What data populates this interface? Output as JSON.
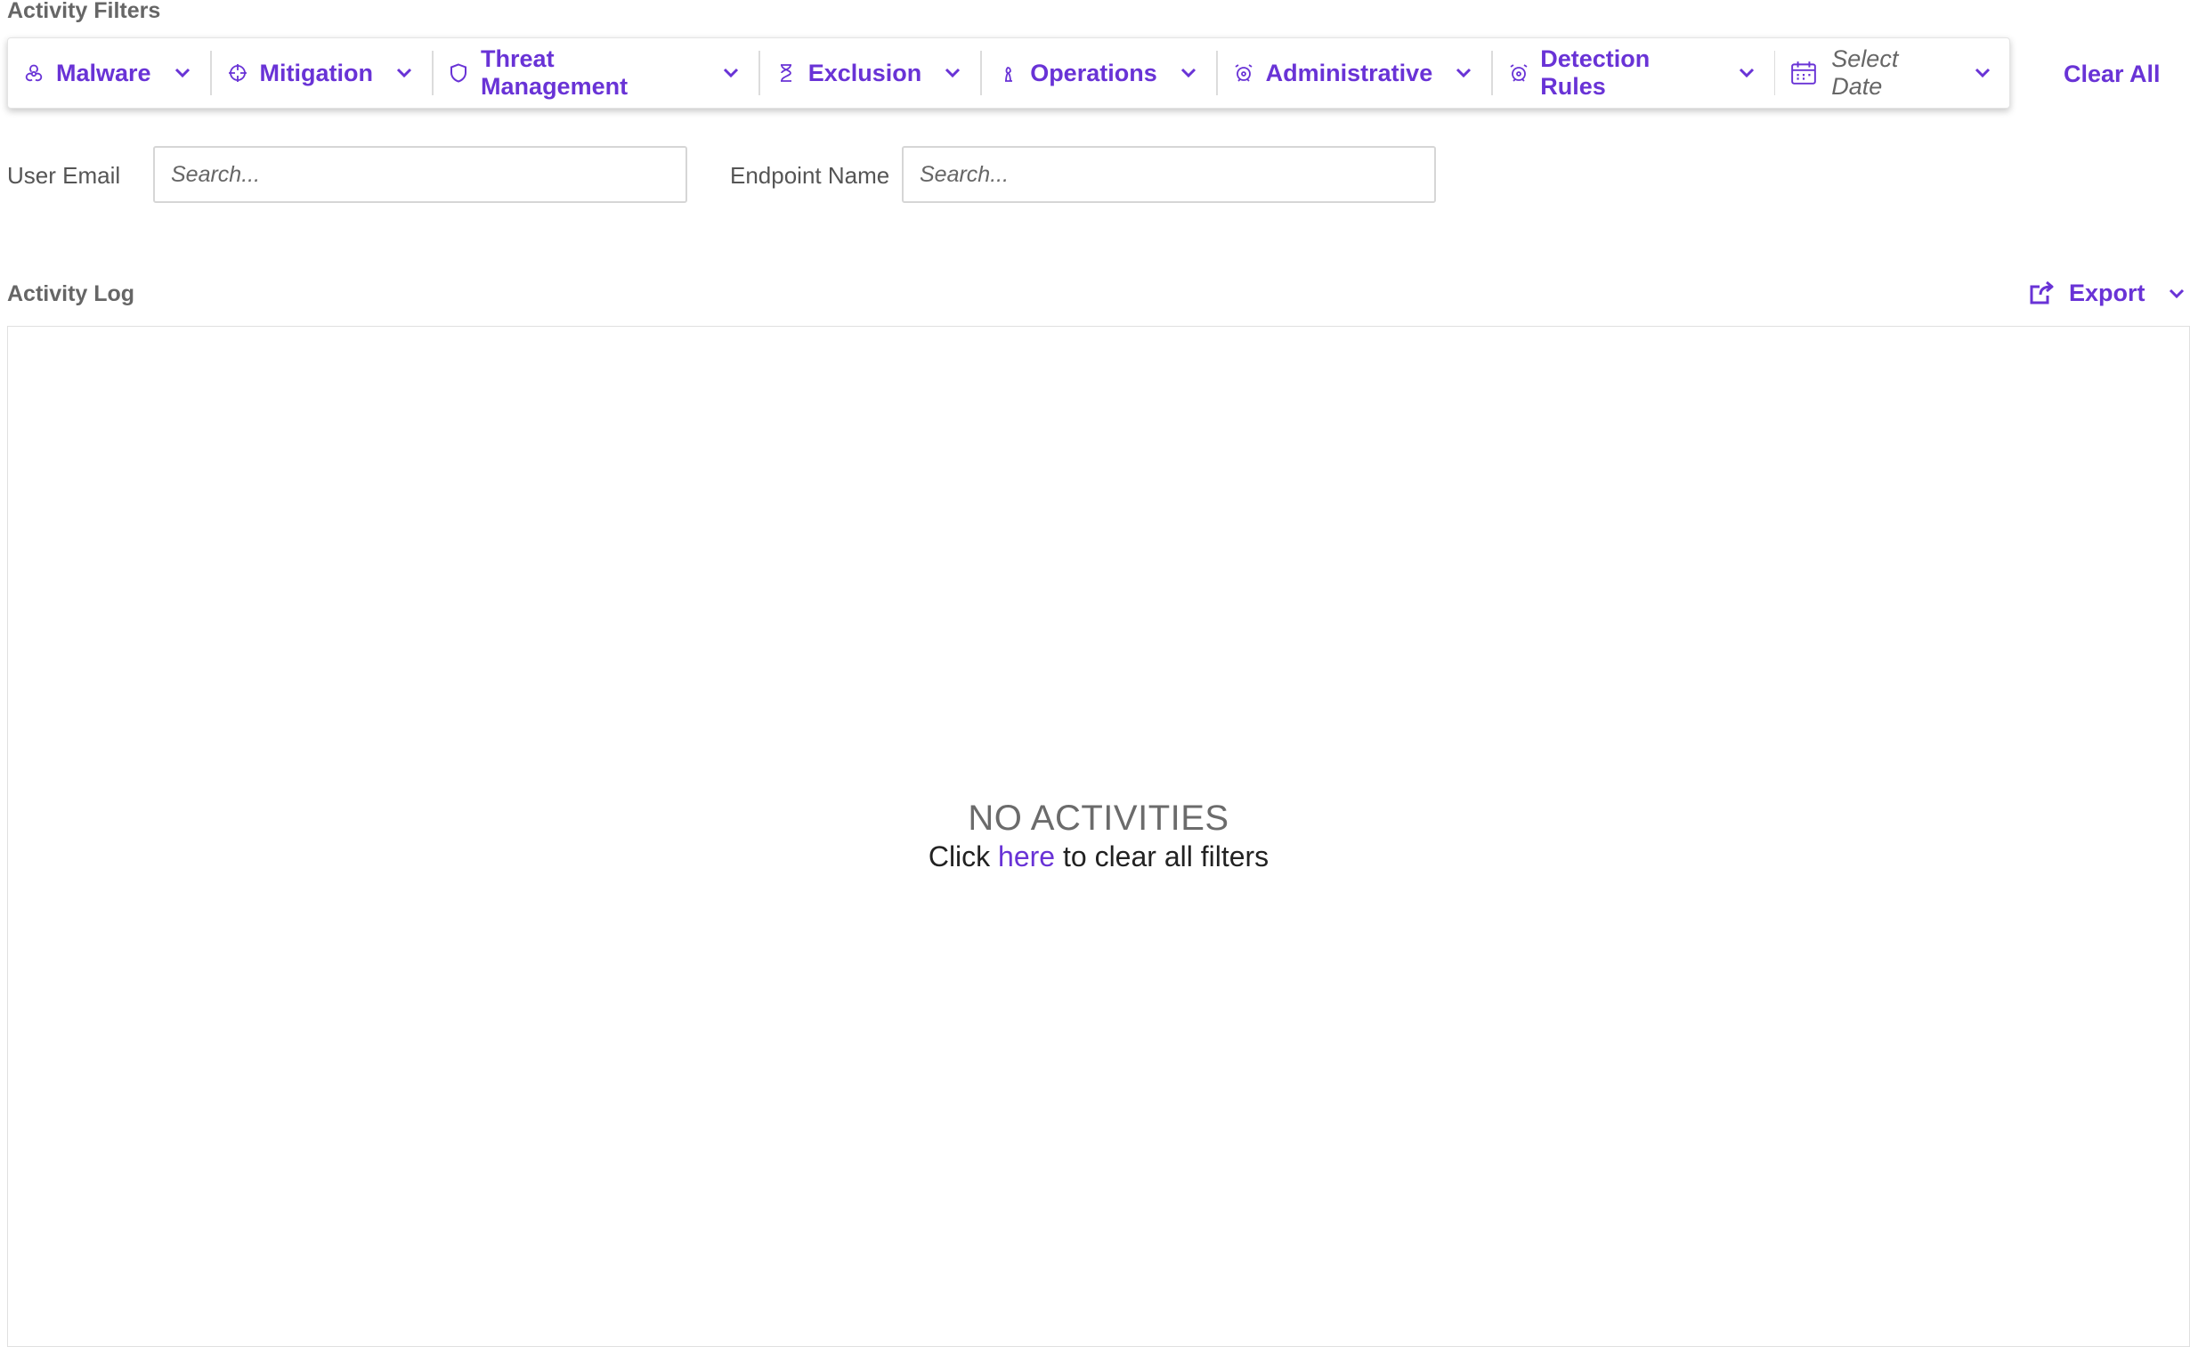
{
  "filters_title": "Activity Filters",
  "filters": [
    {
      "label": "Malware",
      "icon": "biohazard-icon"
    },
    {
      "label": "Mitigation",
      "icon": "crosshair-icon"
    },
    {
      "label": "Threat Management",
      "icon": "shield-icon"
    },
    {
      "label": "Exclusion",
      "icon": "hourglass-icon"
    },
    {
      "label": "Operations",
      "icon": "chess-piece-icon"
    },
    {
      "label": "Administrative",
      "icon": "alarm-icon"
    },
    {
      "label": "Detection Rules",
      "icon": "alarm-icon"
    }
  ],
  "date_filter": {
    "label": "Select Date",
    "icon": "calendar-icon"
  },
  "clear_all_label": "Clear All",
  "search": {
    "user_email_label": "User Email",
    "user_email_placeholder": "Search...",
    "endpoint_name_label": "Endpoint Name",
    "endpoint_name_placeholder": "Search..."
  },
  "log": {
    "title": "Activity Log",
    "export_label": "Export",
    "empty_title": "NO ACTIVITIES",
    "empty_hint_prefix": "Click",
    "empty_hint_link": "here",
    "empty_hint_suffix": "to clear all filters"
  },
  "colors": {
    "accent": "#6933d6",
    "muted_text": "#666666"
  }
}
